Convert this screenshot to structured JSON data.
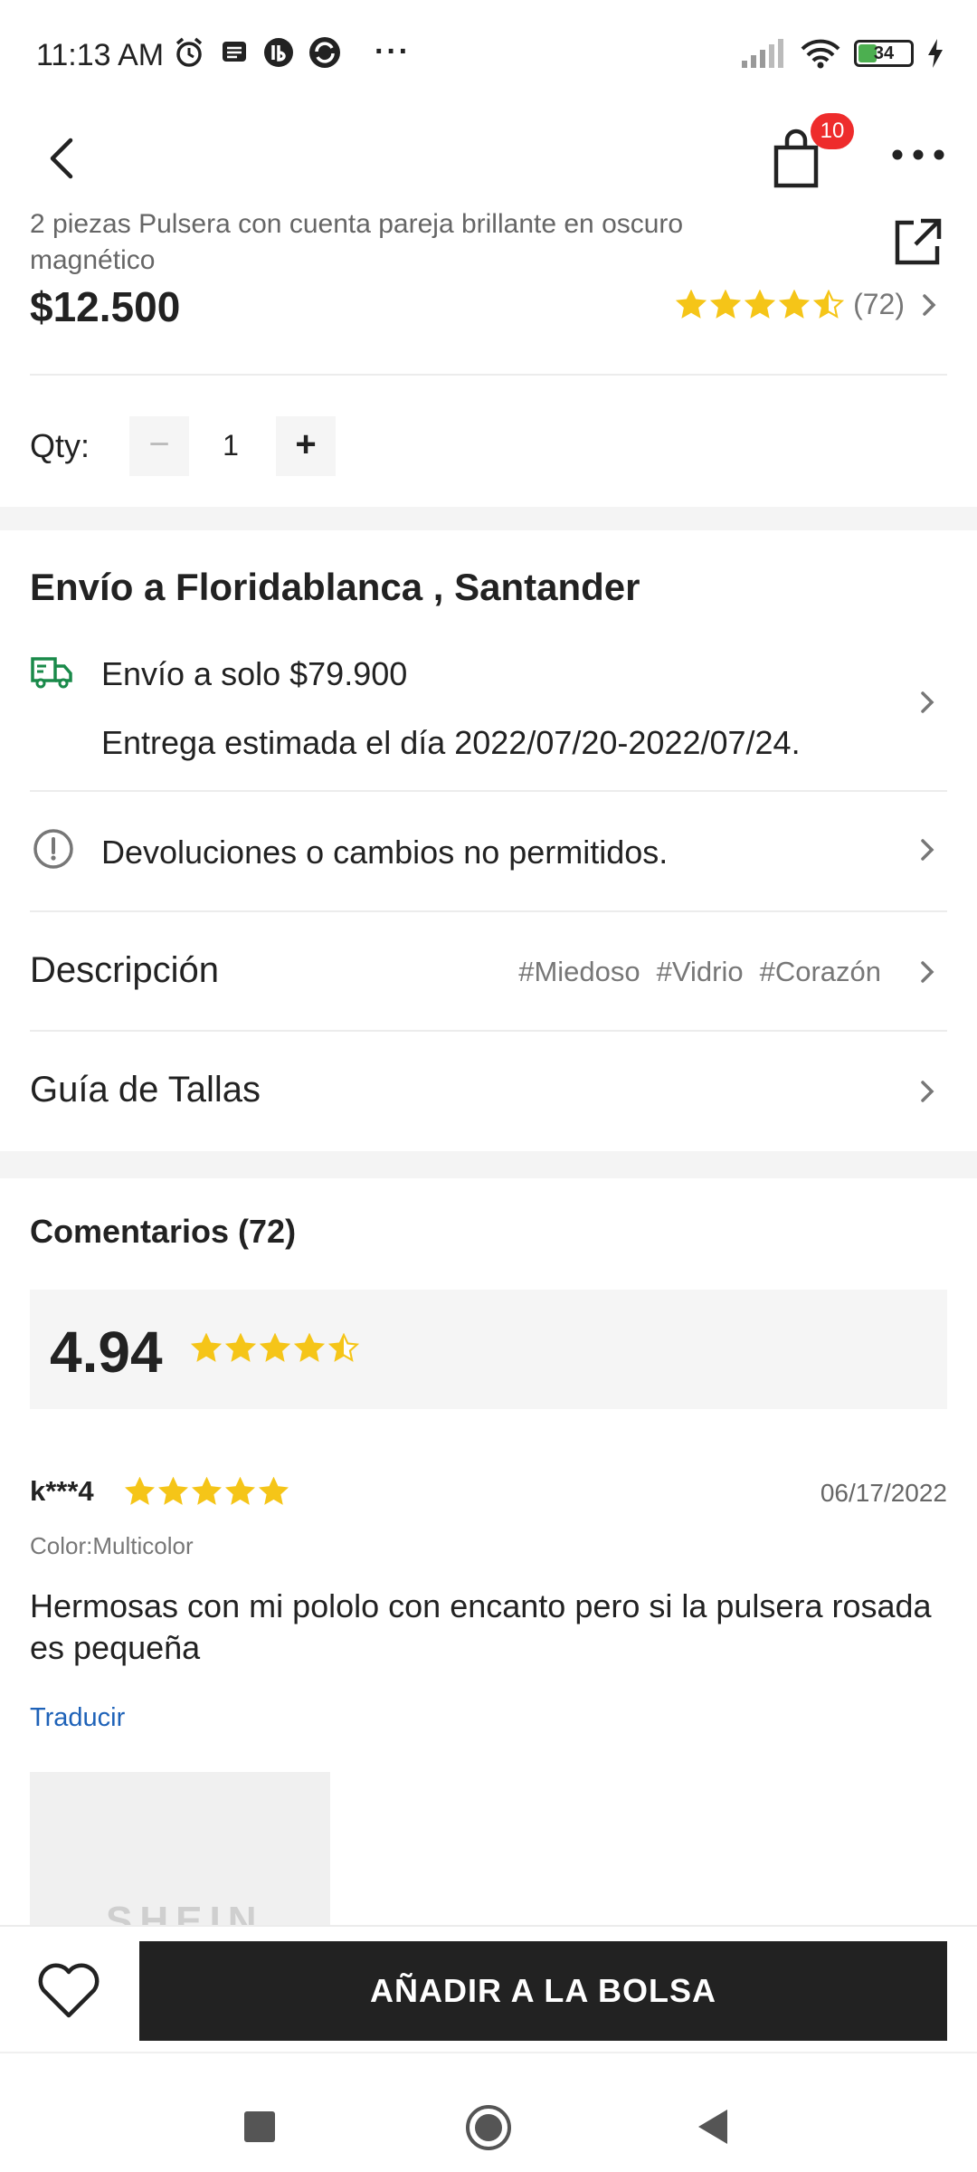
{
  "status_bar": {
    "time": "11:13 AM",
    "more_dots": "···",
    "battery": "34",
    "icons_left": [
      "alarm-icon",
      "message-icon",
      "app-icon",
      "sync-icon"
    ],
    "icons_right": [
      "signal-icon",
      "wifi-icon",
      "battery-icon",
      "charging-icon"
    ]
  },
  "header": {
    "cart_badge": "10"
  },
  "product": {
    "title": "2 piezas Pulsera con cuenta pareja brillante en oscuro magnético",
    "price": "$12.500",
    "rating_stars": 4.5,
    "rating_count": "(72)"
  },
  "quantity": {
    "label": "Qty:",
    "minus": "−",
    "value": "1",
    "plus": "+"
  },
  "shipping": {
    "heading": "Envío a Floridablanca , Santander",
    "price_text": "Envío a solo $79.900",
    "estimate_text": "Entrega estimada el día 2022/07/20-2022/07/24."
  },
  "returns": {
    "text": "Devoluciones o cambios no permitidos."
  },
  "description": {
    "label": "Descripción",
    "tags": [
      "#Miedoso",
      "#Vidrio",
      "#Corazón"
    ]
  },
  "size_guide": {
    "label": "Guía de Tallas"
  },
  "comments": {
    "heading": "Comentarios (72)",
    "score": "4.94",
    "score_stars": 4.5
  },
  "review": {
    "user": "k***4",
    "stars": 5,
    "date": "06/17/2022",
    "color": "Color:Multicolor",
    "text": "Hermosas con mi pololo con encanto pero si la pulsera rosada es pequeña",
    "translate": "Traducir",
    "image_watermark": "SHEIN"
  },
  "bottom_bar": {
    "add_to_bag": "AÑADIR A LA BOLSA"
  },
  "colors": {
    "star": "#f5c518",
    "badge": "#ee2c2c",
    "link": "#1e62b8",
    "primary_button": "#222222",
    "truck_icon": "#1a8a4a"
  }
}
